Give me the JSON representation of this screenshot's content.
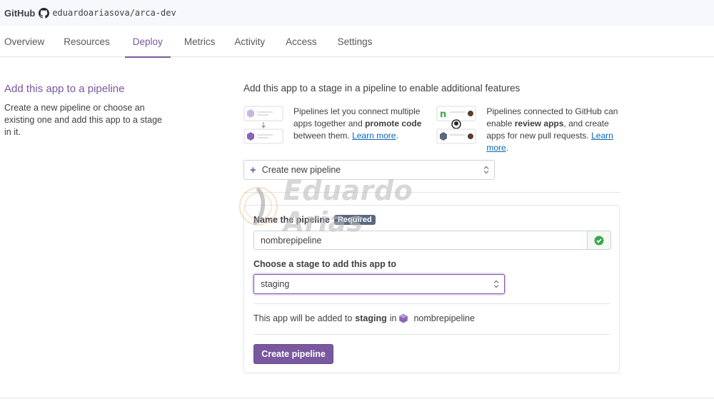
{
  "topbar": {
    "service": "GitHub",
    "repo": "eduardoariasova/arca-dev"
  },
  "tabs": [
    {
      "label": "Overview"
    },
    {
      "label": "Resources"
    },
    {
      "label": "Deploy"
    },
    {
      "label": "Metrics"
    },
    {
      "label": "Activity"
    },
    {
      "label": "Access"
    },
    {
      "label": "Settings"
    }
  ],
  "active_tab": "Deploy",
  "left": {
    "title": "Add this app to a pipeline",
    "description": "Create a new pipeline or choose an existing one and add this app to a stage in it."
  },
  "main": {
    "heading": "Add this app to a stage in a pipeline to enable additional features",
    "feature1": {
      "text_a": "Pipelines let you connect multiple apps together and ",
      "bold": "promote code",
      "text_b": " between them. ",
      "link": "Learn more",
      "end": "."
    },
    "feature2": {
      "text_a": "Pipelines connected to GitHub can enable ",
      "bold": "review apps",
      "text_b": ", and create apps for new pull requests. ",
      "link": "Learn more",
      "end": "."
    },
    "pipeline_select": "Create new pipeline"
  },
  "form": {
    "name_label": "Name the pipeline",
    "required_badge": "Required",
    "name_value": "nombrepipeline",
    "stage_label": "Choose a stage to add this app to",
    "stage_value": "staging",
    "summary_prefix": "This app will be added to",
    "summary_stage": "staging",
    "summary_in": "in",
    "summary_pipeline": "nombrepipeline",
    "create_button": "Create pipeline"
  },
  "watermark": "Eduardo Arias",
  "colors": {
    "accent": "#79589f",
    "link": "#0b66b7",
    "success": "#3aa64a",
    "badge": "#596981"
  }
}
